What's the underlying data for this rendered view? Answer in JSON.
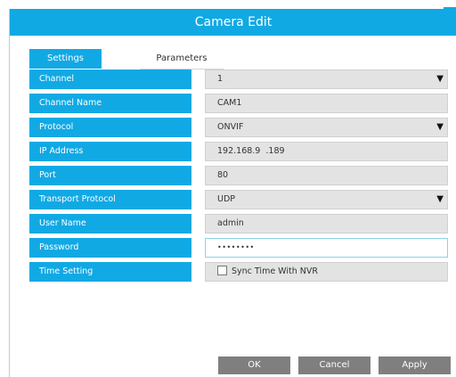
{
  "dialog": {
    "title": "Camera Edit"
  },
  "tabs": [
    {
      "label": "Settings",
      "active": true
    },
    {
      "label": "Parameters",
      "active": false
    }
  ],
  "fields": [
    {
      "label": "Channel",
      "value": "1",
      "kind": "select"
    },
    {
      "label": "Channel Name",
      "value": "CAM1",
      "kind": "text"
    },
    {
      "label": "Protocol",
      "value": "ONVIF",
      "kind": "select"
    },
    {
      "label": "IP Address",
      "value": "192.168.9  .189",
      "kind": "text"
    },
    {
      "label": "Port",
      "value": "80",
      "kind": "text"
    },
    {
      "label": "Transport Protocol",
      "value": "UDP",
      "kind": "select"
    },
    {
      "label": "User Name",
      "value": "admin",
      "kind": "text"
    },
    {
      "label": "Password",
      "value": "••••••••",
      "kind": "password"
    },
    {
      "label": "Time Setting",
      "value": "Sync Time With NVR",
      "kind": "checkbox",
      "checked": false
    }
  ],
  "buttons": {
    "ok": "OK",
    "cancel": "Cancel",
    "apply": "Apply"
  },
  "icons": {
    "dropdown": "▼"
  },
  "colors": {
    "accent": "#11a9e4",
    "button": "#7f7f7f"
  }
}
